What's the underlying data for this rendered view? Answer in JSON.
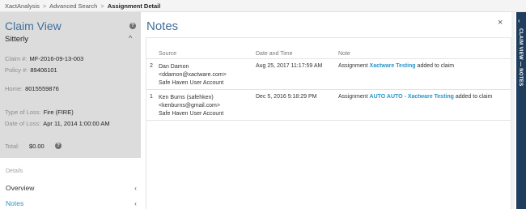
{
  "breadcrumb": {
    "items": [
      "XactAnalysis",
      "Advanced Search"
    ],
    "separator": ">",
    "current": "Assignment Detail"
  },
  "claim": {
    "title": "Claim View",
    "help_icon": "?",
    "name": "Sitterly",
    "collapse_icon": "^",
    "claim_label": "Claim #:",
    "claim_value": "MF-2016-09-13-003",
    "policy_label": "Policy #:",
    "policy_value": "89406101",
    "home_label": "Home:",
    "home_value": "8015559876",
    "type_label": "Type of Loss:",
    "type_value": "Fire (FIRE)",
    "dol_label": "Date of Loss:",
    "dol_value": "Apr 11, 2014 1:00:00 AM",
    "total_label": "Total:",
    "total_value": "$0.00"
  },
  "nav": {
    "section_label": "Details",
    "chevron": "‹",
    "items": [
      {
        "label": "Overview"
      },
      {
        "label": "Notes"
      }
    ]
  },
  "notes": {
    "title": "Notes",
    "close": "×",
    "columns": [
      "Source",
      "Date and Time",
      "Note"
    ],
    "rows": [
      {
        "num": "2",
        "source_name": "Dan Damon",
        "source_email": "<ddamon@xactware.com>",
        "source_account": "Safe Haven User Account",
        "datetime": "Aug 25, 2017 11:17:59 AM",
        "note_prefix": "Assignment",
        "note_link": "Xactware Testing",
        "note_suffix": "added to claim"
      },
      {
        "num": "1",
        "source_name": "Ken Burns (safehken)",
        "source_email": "<kenburns@gmail.com>",
        "source_account": "Safe Haven User Account",
        "datetime": "Dec 5, 2016 5:18:29 PM",
        "note_prefix": "Assignment",
        "note_link": "AUTO AUTO - Xactware Testing",
        "note_suffix": "added to claim"
      }
    ]
  },
  "side_tab": {
    "arrow": "‹",
    "label": "CLAIM VIEW — NOTES",
    "color": "#1f3d5c"
  },
  "colors": {
    "accent_title": "#3f6f9d",
    "link": "#2b95c6",
    "panel_bg": "#dcdcdc"
  }
}
